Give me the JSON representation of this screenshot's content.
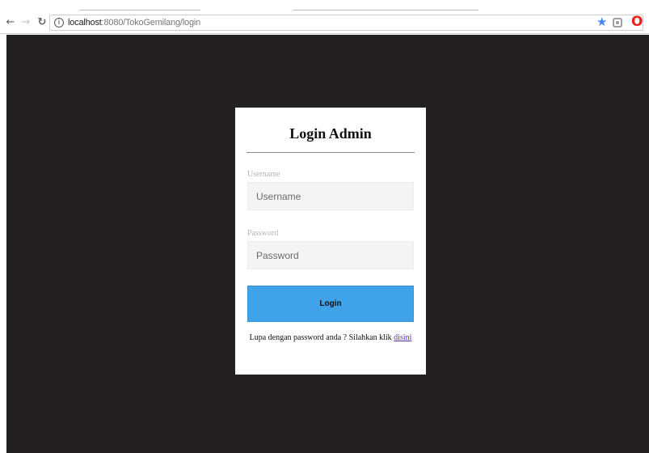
{
  "browser": {
    "url_host": "localhost",
    "url_path": ":8080/TokoGemilang/login",
    "icons": [
      "back-arrow-icon",
      "forward-arrow-icon",
      "reload-icon",
      "info-icon",
      "star-icon",
      "extension-icon",
      "opera-icon"
    ],
    "accent_star": "#4285f4",
    "accent_opera": "#e8231c"
  },
  "page": {
    "background": "#222021"
  },
  "login": {
    "title": "Login Admin",
    "username_label": "Username",
    "username_placeholder": "Username",
    "password_label": "Password",
    "password_placeholder": "Password",
    "button_label": "Login",
    "button_color": "#40a2e8",
    "forgot_text": "Lupa dengan password anda ? Silahkan klik",
    "forgot_link": "disini"
  }
}
